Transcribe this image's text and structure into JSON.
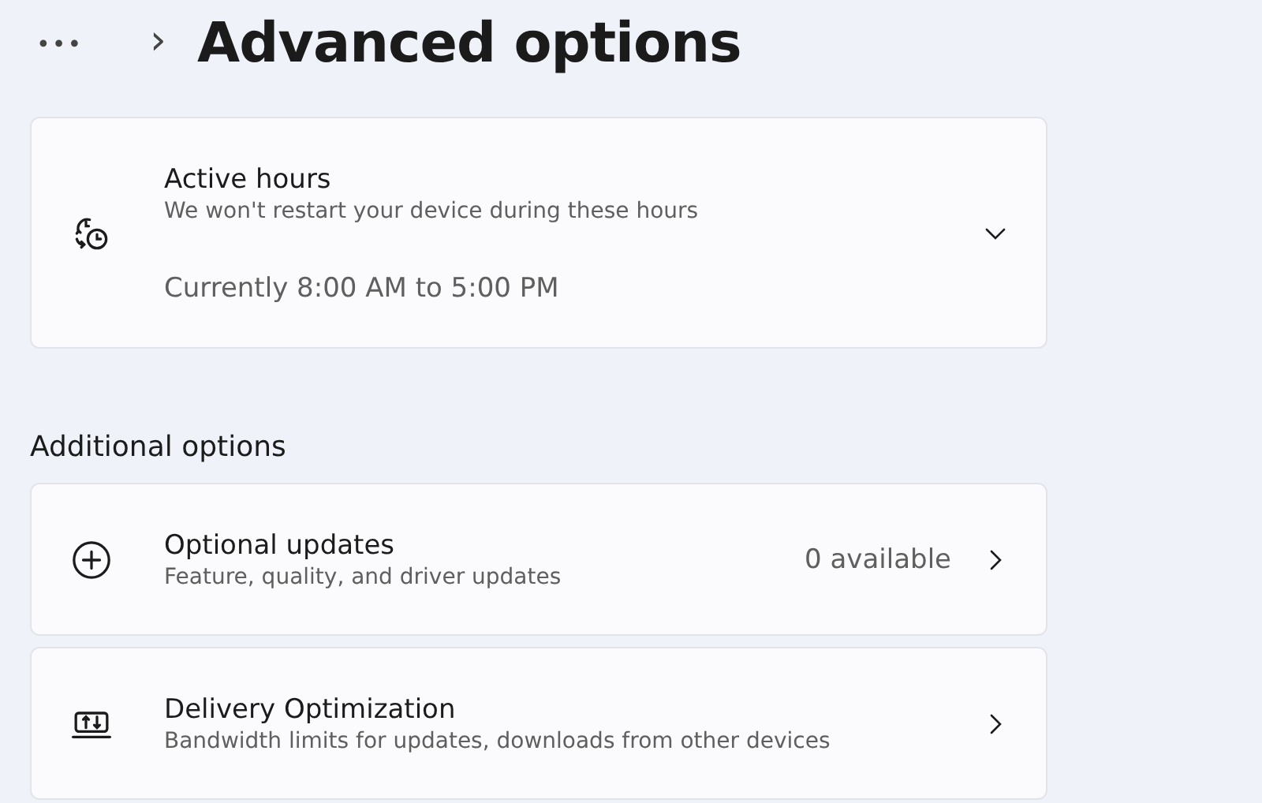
{
  "breadcrumb": {
    "more": "•••",
    "separator": "›",
    "title": "Advanced options"
  },
  "cards": [
    {
      "kind": "expander",
      "expanded": false,
      "title": "Active hours",
      "description": "We won't restart your device during these hours",
      "detail": "Currently 8:00 AM to 5:00 PM"
    }
  ],
  "section": {
    "heading": "Additional options"
  },
  "options": [
    {
      "kind": "link",
      "title": "Optional updates",
      "description": "Feature, quality, and driver updates",
      "value": "0 available"
    },
    {
      "kind": "link",
      "title": "Delivery Optimization",
      "description": "Bandwidth limits for updates, downloads from other devices"
    }
  ]
}
